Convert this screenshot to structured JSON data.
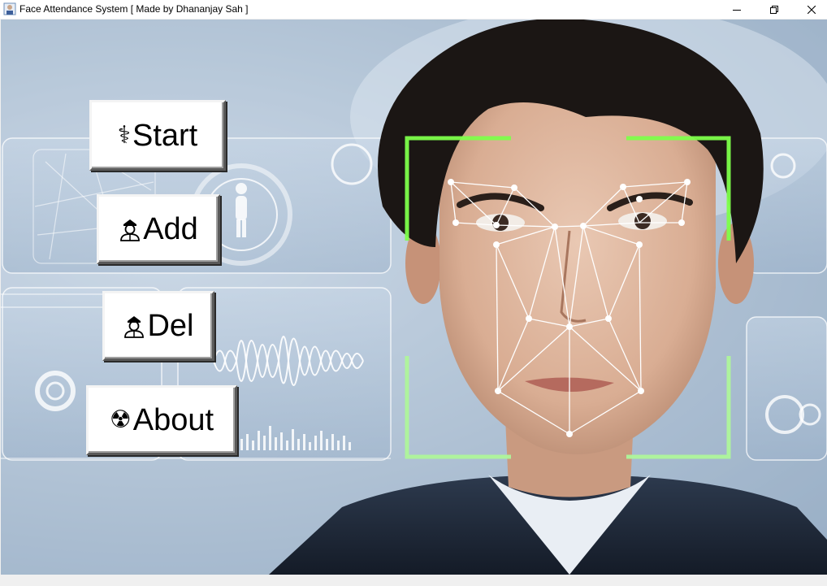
{
  "window": {
    "title": "Face Attendance System [ Made by Dhananjay Sah ]",
    "controls": [
      "minimize",
      "maximize",
      "close"
    ]
  },
  "menu": {
    "start": {
      "label": "Start",
      "icon": "caduceus-icon"
    },
    "add": {
      "label": "Add",
      "icon": "officer-icon"
    },
    "del": {
      "label": "Del",
      "icon": "officer-icon"
    },
    "about": {
      "label": "About",
      "icon": "radioactive-icon"
    }
  },
  "background": {
    "subject": "face-scan-illustration",
    "accent_color": "#7dff4a",
    "line_color": "#ffffff"
  }
}
